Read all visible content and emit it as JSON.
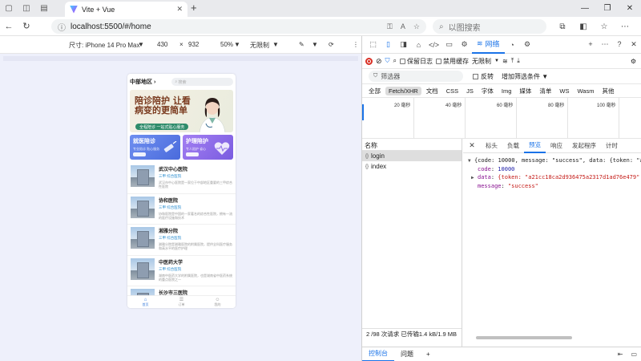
{
  "browser": {
    "tab_title": "Vite + Vue",
    "tab_close": "✕",
    "new_tab": "+",
    "url": "localhost:5500/#/home",
    "search_placeholder": "以图搜索",
    "win_min": "—",
    "win_max": "❐",
    "win_close": "✕"
  },
  "device_toolbar": {
    "size_label": "尺寸: iPhone 14 Pro Max",
    "width": "430",
    "times": "×",
    "height": "932",
    "zoom": "50%",
    "throttle": "无限制"
  },
  "app": {
    "region": "中部地区",
    "search_placeholder": "搜索",
    "banner_title": "陪诊陪护 让看病变的更简单",
    "banner_pill": "全程陪诊 一站式贴心服务",
    "services": [
      {
        "title": "就医陪诊",
        "sub": "专业陪诊 贴心服务"
      },
      {
        "title": "护理陪护",
        "sub": "专人陪护 省心"
      }
    ],
    "hospitals": [
      {
        "name": "武汉中心医院",
        "tag": "三甲  综合医院",
        "desc": "武汉市中心医院是一家位于中部地区重要的三甲综合性医院"
      },
      {
        "name": "协和医院",
        "tag": "三甲  综合医院",
        "desc": "协和医院是中国的一家著名的综合性医院，拥有一流的医疗设施和技术"
      },
      {
        "name": "湘雅分院",
        "tag": "三甲  综合医院",
        "desc": "湘雅分院是湘雅医院的附属医院，提供全科医疗服务和高水平的医疗护理"
      },
      {
        "name": "中医药大学",
        "tag": "三甲  综合医院",
        "desc": "湖南中医药大学的附属医院，也是湖南省中医药系统的重点医院之一"
      },
      {
        "name": "长沙市三医院",
        "tag": "",
        "desc": ""
      }
    ],
    "nav": [
      {
        "icon": "⌂",
        "label": "首页"
      },
      {
        "icon": "☰",
        "label": "订单"
      },
      {
        "icon": "☺",
        "label": "我的"
      }
    ]
  },
  "devtools": {
    "network_tab": "网络",
    "preserve_log": "保留日志",
    "disable_cache": "禁用缓存",
    "throttle": "无限制",
    "filter_placeholder": "筛选器",
    "invert": "反转",
    "more_filters": "增加筛选条件",
    "types": [
      "全部",
      "Fetch/XHR",
      "文档",
      "CSS",
      "JS",
      "字体",
      "Img",
      "媒体",
      "清单",
      "WS",
      "Wasm",
      "其他"
    ],
    "timeline_ticks": [
      "20 毫秒",
      "40 毫秒",
      "60 毫秒",
      "80 毫秒",
      "100 毫秒"
    ],
    "name_header": "名称",
    "requests": [
      "login",
      "index"
    ],
    "status_bar": "2 /98 次请求   已传输1.4 kB/1.9 MB",
    "detail_tabs": [
      "标头",
      "负载",
      "预览",
      "响应",
      "发起程序",
      "计时"
    ],
    "preview": {
      "summary": "{code: 10000, message: \"success\", data: {token: \"a21",
      "code_key": "code",
      "code_val": "10000",
      "data_key": "data",
      "data_val": "{token: \"a21cc18ca2d936475a2317d1ad76e479\"",
      "message_key": "message",
      "message_val": "\"success\""
    },
    "drawer_tabs": [
      "控制台",
      "问题"
    ],
    "drawer_add": "+"
  }
}
